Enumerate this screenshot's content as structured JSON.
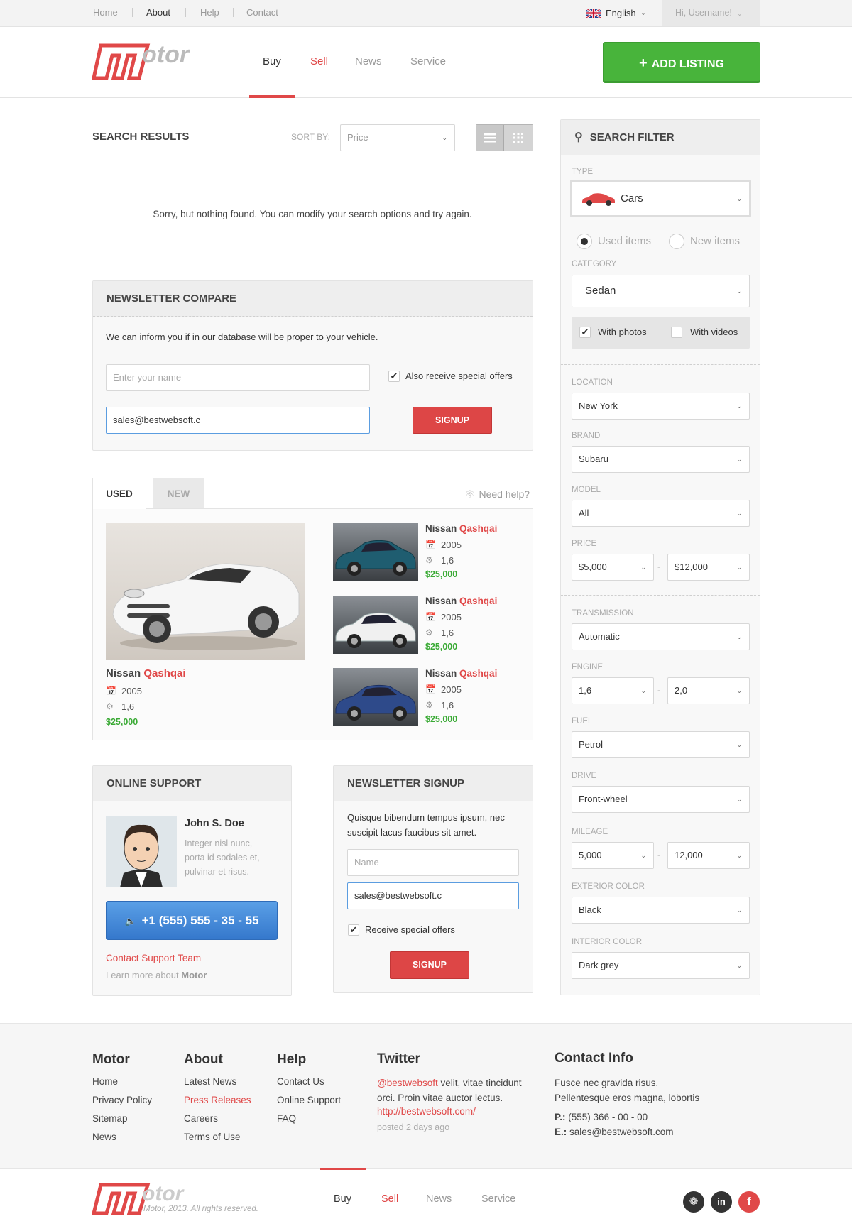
{
  "topbar": {
    "links": [
      "Home",
      "About",
      "Help",
      "Contact"
    ],
    "language": "English",
    "user": "Hi, Username!"
  },
  "header": {
    "logo_text": "Motor",
    "nav": [
      "Buy",
      "Sell",
      "News",
      "Service"
    ],
    "add_listing": "ADD LISTING"
  },
  "results": {
    "title": "SEARCH RESULTS",
    "sort_label": "SORT BY:",
    "sort_value": "Price",
    "empty_message": "Sorry, but nothing found. You can modify your search options and try again."
  },
  "newsletter_compare": {
    "title": "NEWSLETTER COMPARE",
    "text": "We can inform you if in our database will be proper to your vehicle.",
    "name_placeholder": "Enter your name",
    "email_value": "sales@bestwebsoft.c",
    "checkbox_label": "Also receive special offers",
    "button": "SIGNUP"
  },
  "tabs": {
    "used": "USED",
    "new": "NEW",
    "help": "Need help?"
  },
  "featured": {
    "make": "Nissan",
    "model": "Qashqai",
    "year": "2005",
    "engine": "1,6",
    "price": "$25,000"
  },
  "listings": [
    {
      "make": "Nissan",
      "model": "Qashqai",
      "year": "2005",
      "engine": "1,6",
      "price": "$25,000",
      "image": "car-green-sedan"
    },
    {
      "make": "Nissan",
      "model": "Qashqai",
      "year": "2005",
      "engine": "1,6",
      "price": "$25,000",
      "image": "car-white-hatch"
    },
    {
      "make": "Nissan",
      "model": "Qashqai",
      "year": "2005",
      "engine": "1,6",
      "price": "$25,000",
      "image": "car-blue-coupe"
    }
  ],
  "support": {
    "title": "ONLINE SUPPORT",
    "name": "John S. Doe",
    "text": "Integer nisl nunc, porta id sodales et, pulvinar et risus.",
    "phone": "+1 (555) 555 - 35 - 55",
    "contact_link": "Contact Support Team",
    "learn_more": "Learn more about",
    "learn_more_bold": "Motor"
  },
  "newsletter_signup": {
    "title": "NEWSLETTER SIGNUP",
    "text": "Quisque bibendum tempus ipsum, nec suscipit lacus faucibus sit amet.",
    "name_placeholder": "Name",
    "email_value": "sales@bestwebsoft.c",
    "checkbox_label": "Receive special offers",
    "button": "SIGNUP"
  },
  "filter": {
    "title": "SEARCH FILTER",
    "type_label": "TYPE",
    "type_value": "Cars",
    "used_items": "Used items",
    "new_items": "New items",
    "category_label": "CATEGORY",
    "category_value": "Sedan",
    "with_photos": "With photos",
    "with_videos": "With videos",
    "location_label": "LOCATION",
    "location_value": "New York",
    "brand_label": "BRAND",
    "brand_value": "Subaru",
    "model_label": "MODEL",
    "model_value": "All",
    "price_label": "PRICE",
    "price_from": "$5,000",
    "price_to": "$12,000",
    "transmission_label": "TRANSMISSION",
    "transmission_value": "Automatic",
    "engine_label": "ENGINE",
    "engine_from": "1,6",
    "engine_to": "2,0",
    "fuel_label": "FUEL",
    "fuel_value": "Petrol",
    "drive_label": "DRIVE",
    "drive_value": "Front-wheel",
    "mileage_label": "MILEAGE",
    "mileage_from": "5,000",
    "mileage_to": "12,000",
    "exterior_label": "EXTERIOR COLOR",
    "exterior_value": "Black",
    "interior_label": "INTERIOR COLOR",
    "interior_value": "Dark grey",
    "range_sep": "-"
  },
  "footer": {
    "col1_title": "Motor",
    "col1_links": [
      "Home",
      "Privacy Policy",
      "Sitemap",
      "News"
    ],
    "col2_title": "About",
    "col2_links": [
      "Latest News",
      "Press Releases",
      "Careers",
      "Terms of Use"
    ],
    "col3_title": "Help",
    "col3_links": [
      "Contact Us",
      "Online Support",
      "FAQ"
    ],
    "twitter_title": "Twitter",
    "twitter_handle": "@bestwebsoft",
    "twitter_text1": " velit, vitae tincidunt",
    "twitter_text2": "orci. Proin vitae auctor lectus.",
    "twitter_link": "http://bestwebsoft.com/",
    "twitter_time": "posted 2 days ago",
    "contact_title": "Contact Info",
    "contact_line1": "Fusce nec gravida risus.",
    "contact_line2": "Pellentesque eros magna, lobortis",
    "phone_label": "P.:",
    "phone": "(555) 366 - 00 - 00",
    "email_label": "E.:",
    "email": "sales@bestwebsoft.com",
    "copyright": "Motor, 2013. All rights reserved.",
    "nav": [
      "Buy",
      "Sell",
      "News",
      "Service"
    ]
  },
  "colors": {
    "accent": "#e04848",
    "green": "#48b43b",
    "blue": "#3d86d6"
  }
}
